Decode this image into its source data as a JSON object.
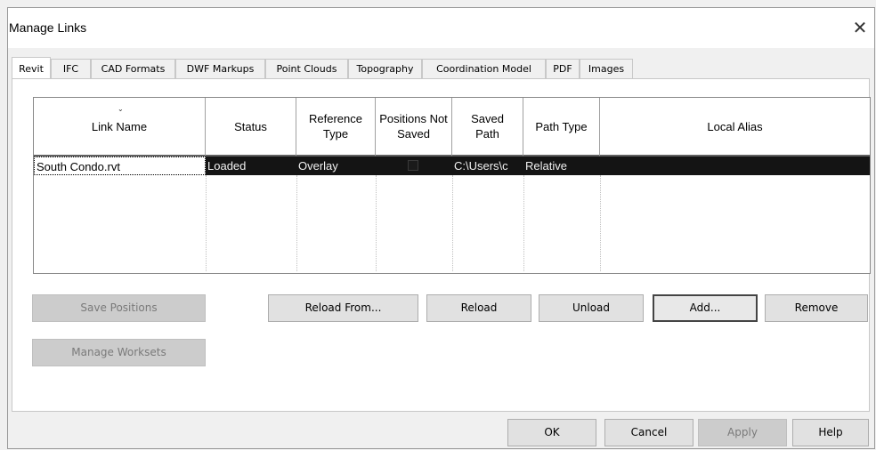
{
  "dialog": {
    "title": "Manage Links",
    "close_symbol": "✕",
    "close_icon": "close-icon"
  },
  "tabs": [
    {
      "label": "Revit"
    },
    {
      "label": "IFC"
    },
    {
      "label": "CAD Formats"
    },
    {
      "label": "DWF Markups"
    },
    {
      "label": "Point Clouds"
    },
    {
      "label": "Topography"
    },
    {
      "label": "Coordination Model"
    },
    {
      "label": "PDF"
    },
    {
      "label": "Images"
    }
  ],
  "active_tab": "Revit",
  "grid": {
    "sort_indicator": "⌄",
    "sort_icon": "sort-descending-icon",
    "columns": [
      {
        "label": "Link Name"
      },
      {
        "label": "Status"
      },
      {
        "label": "Reference Type"
      },
      {
        "label": "Positions Not Saved"
      },
      {
        "label": "Saved Path"
      },
      {
        "label": "Path Type"
      },
      {
        "label": "Local Alias"
      }
    ],
    "rows": [
      {
        "link_name": "South Condo.rvt",
        "status": "Loaded",
        "reference_type": "Overlay",
        "positions_not_saved": false,
        "saved_path": "C:\\Users\\c",
        "path_type": "Relative",
        "local_alias": ""
      }
    ]
  },
  "buttons": {
    "save_positions": "Save Positions",
    "manage_worksets": "Manage Worksets",
    "reload_from": "Reload From...",
    "reload": "Reload",
    "unload": "Unload",
    "add": "Add...",
    "remove": "Remove"
  },
  "footer": {
    "ok": "OK",
    "cancel": "Cancel",
    "apply": "Apply",
    "help": "Help"
  },
  "colors": {
    "selected_row_bg": "#141414",
    "selected_row_text": "#f0f0f0",
    "disabled_button_bg": "#cccccc"
  }
}
